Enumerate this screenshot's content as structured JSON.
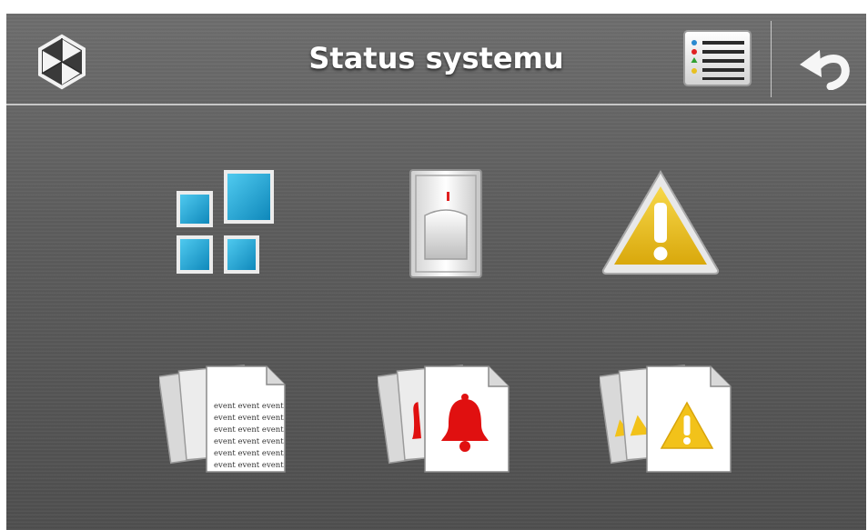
{
  "header": {
    "title": "Status systemu"
  },
  "tiles": [
    {
      "name": "zones-status",
      "icon": "zones-grid-icon"
    },
    {
      "name": "detector-status",
      "icon": "motion-detector-icon"
    },
    {
      "name": "troubles",
      "icon": "warning-triangle-icon"
    },
    {
      "name": "event-log",
      "icon": "event-documents-icon",
      "doc_text": "event event event"
    },
    {
      "name": "alarm-log",
      "icon": "alarm-bell-documents-icon"
    },
    {
      "name": "trouble-log",
      "icon": "warning-documents-icon"
    }
  ],
  "colors": {
    "accent_blue": "#1aa0d0",
    "warning_yellow": "#f2c21a",
    "alarm_red": "#e01010"
  }
}
